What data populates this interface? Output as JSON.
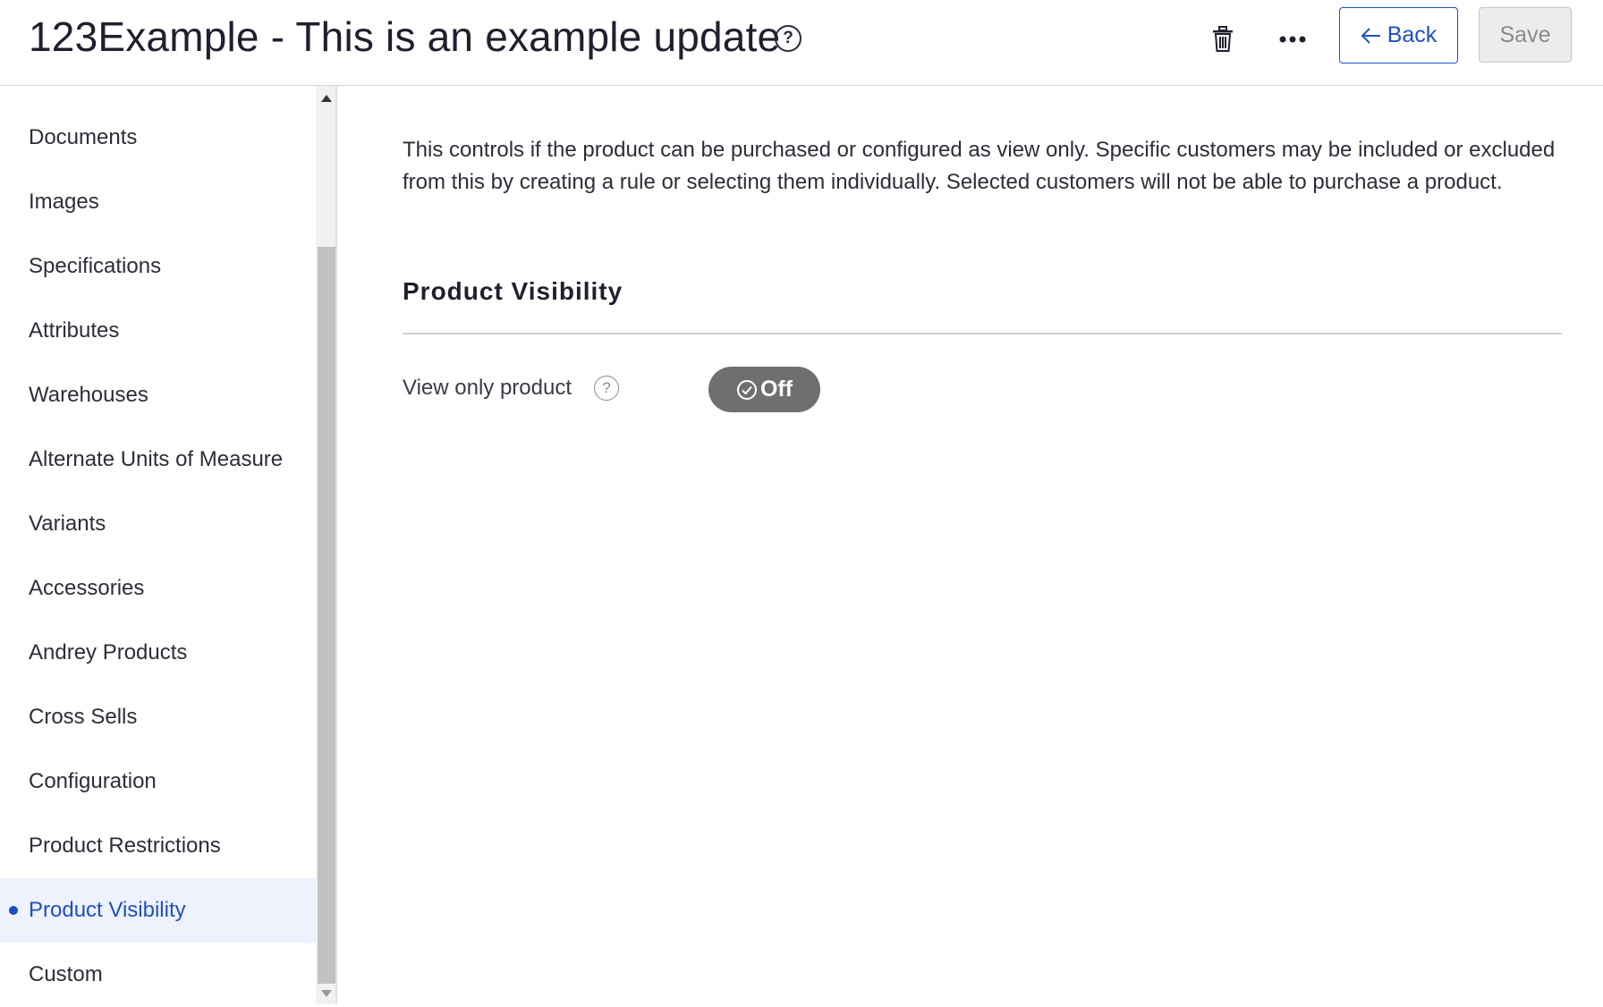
{
  "header": {
    "title": "123Example - This is an example update",
    "help_icon": "help-circle-icon",
    "delete_icon": "trash-icon",
    "more_icon": "more-horizontal-icon",
    "back_label": "Back",
    "save_label": "Save",
    "accent_color": "#1f4fbf"
  },
  "sidebar": {
    "items": [
      {
        "label": "Documents"
      },
      {
        "label": "Images"
      },
      {
        "label": "Specifications"
      },
      {
        "label": "Attributes"
      },
      {
        "label": "Warehouses"
      },
      {
        "label": "Alternate Units of Measure"
      },
      {
        "label": "Variants"
      },
      {
        "label": "Accessories"
      },
      {
        "label": "Andrey Products"
      },
      {
        "label": "Cross Sells"
      },
      {
        "label": "Configuration"
      },
      {
        "label": "Product Restrictions"
      },
      {
        "label": "Product Visibility",
        "active": true
      },
      {
        "label": "Custom"
      }
    ]
  },
  "main": {
    "description": "This controls if the product can be purchased or configured as view only. Specific customers may be included or excluded from this by creating a rule or selecting them individually. Selected customers will not be able to purchase a product.",
    "section_title": "Product Visibility",
    "field": {
      "label": "View only product",
      "toggle_label": "Off",
      "toggle_on": false
    }
  }
}
